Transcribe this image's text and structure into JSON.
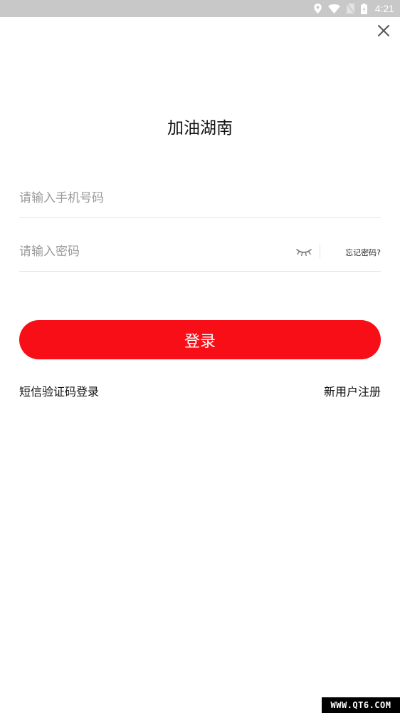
{
  "status_bar": {
    "time": "4:21",
    "icons": [
      "location-icon",
      "wifi-icon",
      "no-sim-icon",
      "battery-icon"
    ],
    "background": "#c8c8c8"
  },
  "header": {
    "close_icon": "close-icon"
  },
  "title": "加油湖南",
  "form": {
    "phone_placeholder": "请输入手机号码",
    "password_placeholder": "请输入密码",
    "eye_icon": "eye-closed-icon",
    "forgot_password": "忘记密码?"
  },
  "login_button": {
    "label": "登录",
    "color": "#f70e17"
  },
  "links": {
    "sms_login": "短信验证码登录",
    "register": "新用户注册"
  },
  "watermark": "WWW.QT6.COM"
}
